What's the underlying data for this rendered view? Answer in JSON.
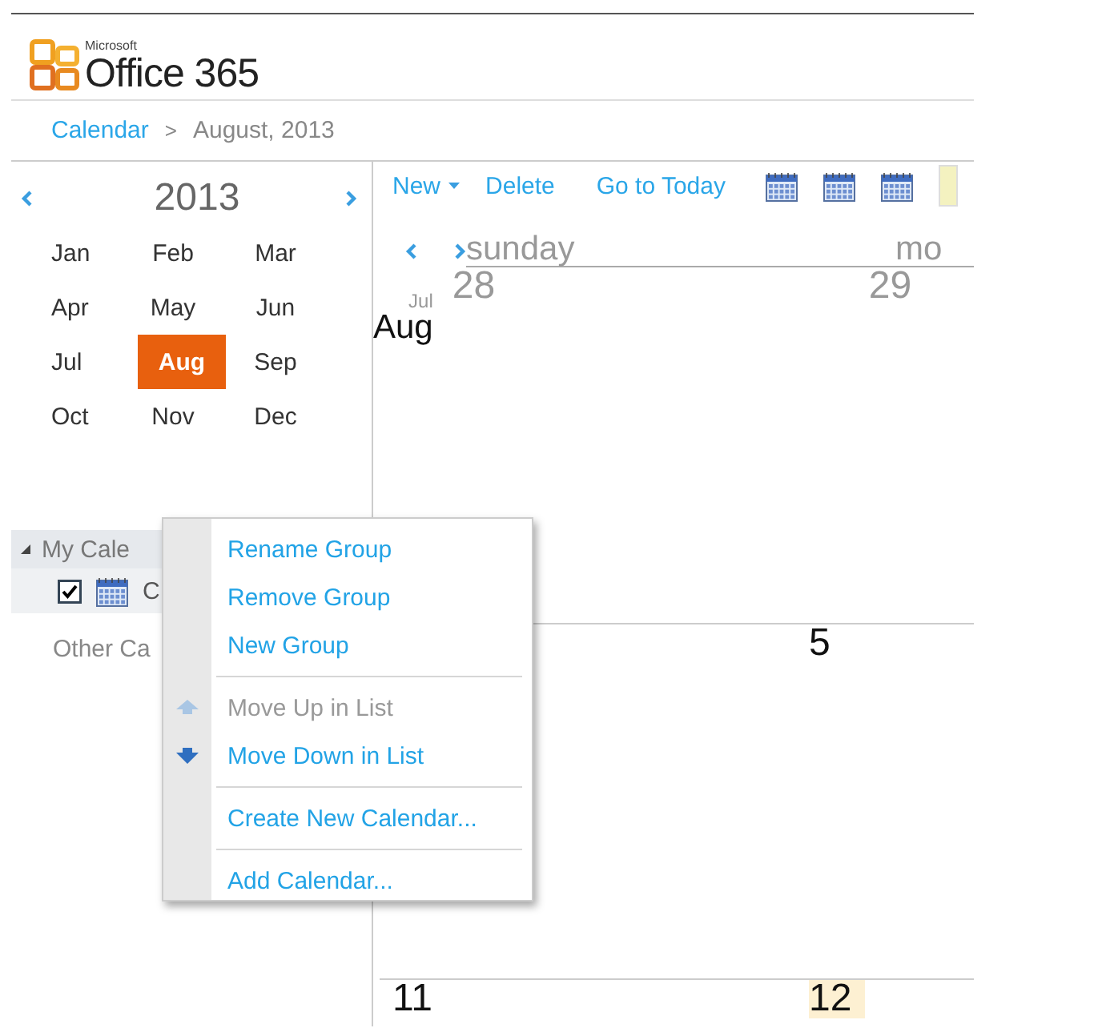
{
  "logo": {
    "maker": "Microsoft",
    "product": "Office 365"
  },
  "breadcrumb": [
    "Calendar",
    "August, 2013"
  ],
  "breadcrumb_separator": ">",
  "year": "2013",
  "months": [
    {
      "label": "Jan",
      "selected": false
    },
    {
      "label": "Feb",
      "selected": false
    },
    {
      "label": "Mar",
      "selected": false
    },
    {
      "label": "Apr",
      "selected": false
    },
    {
      "label": "May",
      "selected": false
    },
    {
      "label": "Jun",
      "selected": false
    },
    {
      "label": "Jul",
      "selected": false
    },
    {
      "label": "Aug",
      "selected": true
    },
    {
      "label": "Sep",
      "selected": false
    },
    {
      "label": "Oct",
      "selected": false
    },
    {
      "label": "Nov",
      "selected": false
    },
    {
      "label": "Dec",
      "selected": false
    }
  ],
  "my_calendars": {
    "label": "My Cale",
    "expanded": true,
    "calendars": [
      {
        "label": "C",
        "checked": true
      }
    ]
  },
  "other_calendars": {
    "label": "Other Ca"
  },
  "toolbar": [
    {
      "label": "New",
      "kind": "dropdown"
    },
    {
      "label": "Delete",
      "kind": "plain"
    },
    {
      "label": "Go to Today",
      "kind": "plain"
    }
  ],
  "day_names": [
    "sunday",
    "mo"
  ],
  "weeks": [
    {
      "month_before": "Jul",
      "month": "Aug",
      "cells": [
        {
          "label": "28",
          "kind": "other_month"
        },
        {
          "label": "29",
          "kind": "other_month"
        }
      ]
    },
    {
      "cells": [
        null,
        {
          "label": "5",
          "kind": "current"
        }
      ]
    },
    {
      "cells": [
        {
          "label": "11",
          "kind": "current"
        },
        {
          "label": "12",
          "kind": "today"
        }
      ]
    }
  ],
  "context_menu": [
    {
      "kind": "item",
      "label": "Rename Group",
      "disabled": false
    },
    {
      "kind": "item",
      "label": "Remove Group",
      "disabled": false
    },
    {
      "kind": "item",
      "label": "New Group",
      "disabled": false
    },
    {
      "kind": "separator"
    },
    {
      "kind": "up",
      "label": "Move Up in List",
      "disabled": true
    },
    {
      "kind": "down",
      "label": "Move Down in List",
      "disabled": false
    },
    {
      "kind": "separator"
    },
    {
      "kind": "item",
      "label": "Create New Calendar...",
      "disabled": false
    },
    {
      "kind": "separator"
    },
    {
      "kind": "item",
      "label": "Add Calendar...",
      "disabled": false
    }
  ]
}
